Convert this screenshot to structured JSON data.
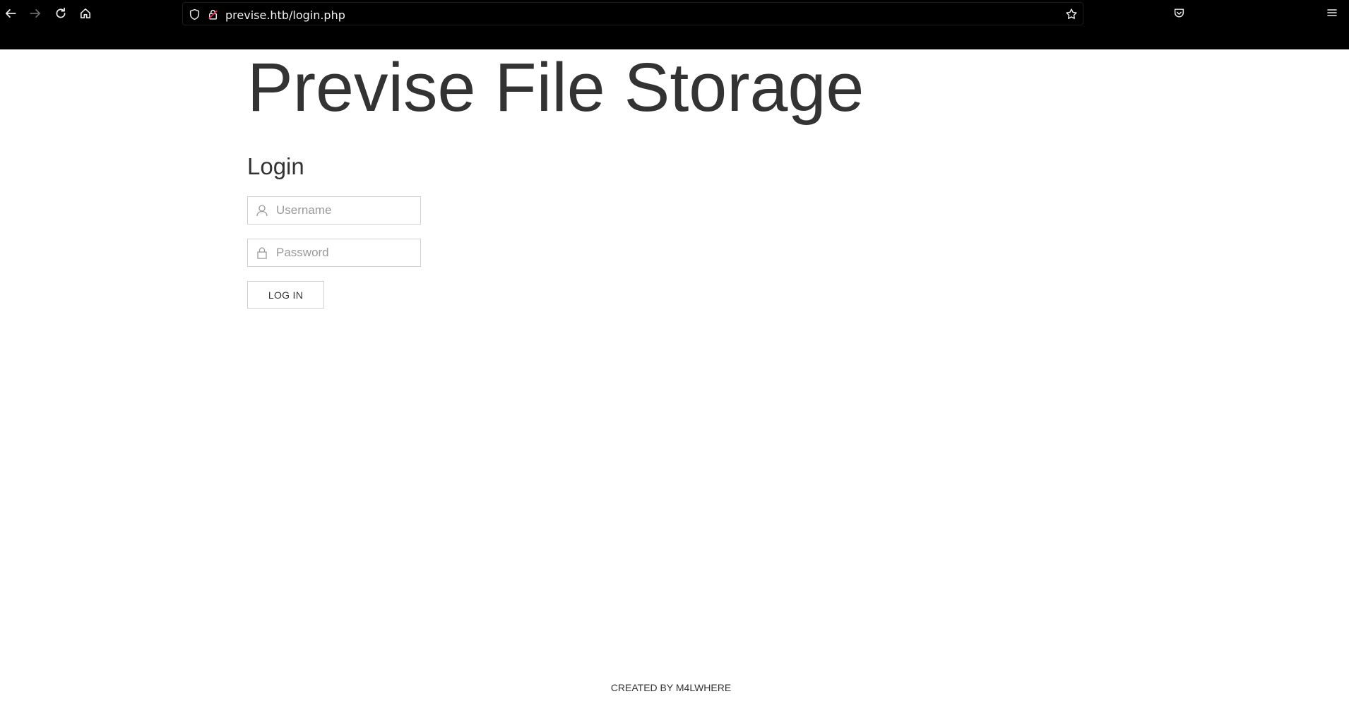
{
  "browser": {
    "url": "previse.htb/login.php",
    "icons": {
      "back": "arrow-left-icon",
      "forward": "arrow-right-icon",
      "reload": "reload-icon",
      "home": "home-icon",
      "shield": "shield-icon",
      "lock": "lock-icon",
      "bookmark": "star-icon",
      "pocket": "pocket-icon",
      "menu": "hamburger-menu-icon"
    }
  },
  "page": {
    "site_title": "Previse File Storage",
    "login_heading": "Login",
    "username_placeholder": "Username",
    "username_value": "",
    "password_placeholder": "Password",
    "password_value": "",
    "login_button": "LOG IN",
    "footer": "CREATED BY M4LWHERE"
  },
  "colors": {
    "browser_bar": "#000000",
    "text": "#333333",
    "placeholder": "#999999",
    "border": "#d0d0d0"
  }
}
